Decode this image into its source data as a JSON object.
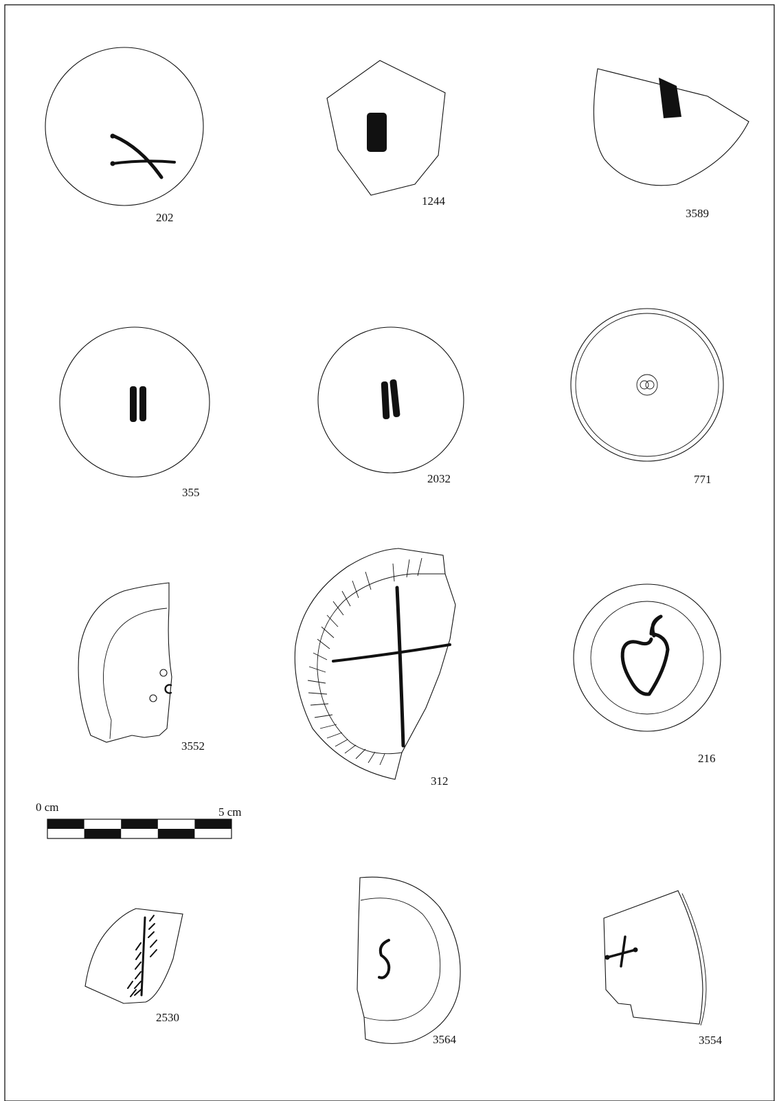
{
  "labels": {
    "s202": "202",
    "s1244": "1244",
    "s3589": "3589",
    "s355": "355",
    "s2032": "2032",
    "s771": "771",
    "s3552": "3552",
    "s312": "312",
    "s216": "216",
    "s2530": "2530",
    "s3564": "3564",
    "s3554": "3554"
  },
  "scale_bar": {
    "start_label": "0 cm",
    "end_label": "5 cm"
  },
  "colors": {
    "ink": "#111111",
    "background": "#ffffff"
  }
}
